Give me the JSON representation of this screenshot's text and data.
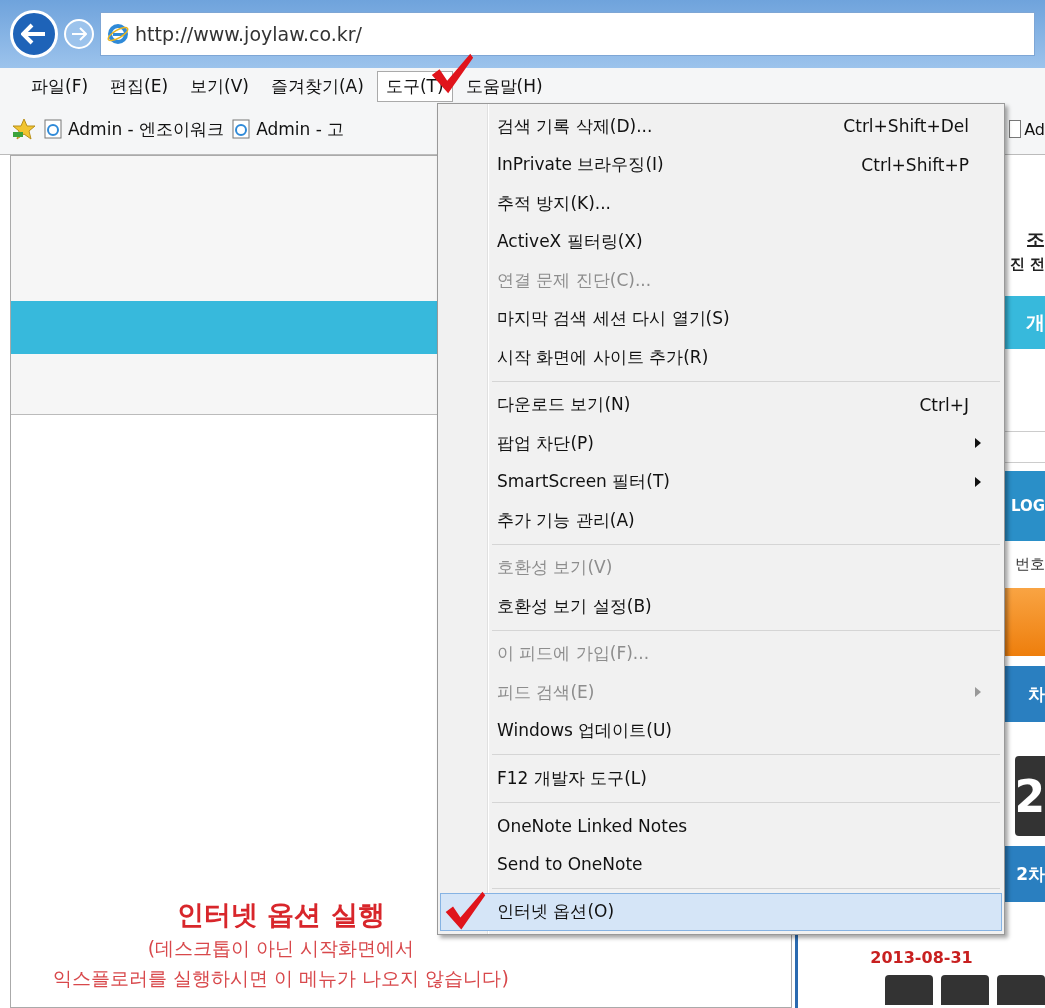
{
  "address_bar": {
    "url": "http://www.joylaw.co.kr/"
  },
  "menu_bar": [
    {
      "label": "파일(F)",
      "selected": false
    },
    {
      "label": "편집(E)",
      "selected": false
    },
    {
      "label": "보기(V)",
      "selected": false
    },
    {
      "label": "즐겨찾기(A)",
      "selected": false
    },
    {
      "label": "도구(T)",
      "selected": true
    },
    {
      "label": "도움말(H)",
      "selected": false
    }
  ],
  "favorites": [
    "Admin - 엔조이워크",
    "Admin - 고",
    "Ad"
  ],
  "right_panel": {
    "title": "조",
    "subtitle": "진 전",
    "tab": "개",
    "login_button": "LOG",
    "label": "번호",
    "button_1": "차",
    "tile": "2",
    "button_2": "2차",
    "date": "2013-08-31"
  },
  "annotation": {
    "title": "인터넷 옵션 실행",
    "lines": [
      "(데스크톱이 아닌 시작화면에서",
      "익스플로러를 실행하시면 이 메뉴가 나오지 않습니다)"
    ]
  },
  "tools_menu": [
    {
      "items": [
        {
          "label": "검색 기록 삭제(D)...",
          "shortcut": "Ctrl+Shift+Del",
          "disabled": false,
          "submenu": false,
          "selected": false
        },
        {
          "label": "InPrivate 브라우징(I)",
          "shortcut": "Ctrl+Shift+P",
          "disabled": false,
          "submenu": false,
          "selected": false
        },
        {
          "label": "추적 방지(K)...",
          "disabled": false,
          "submenu": false,
          "selected": false
        },
        {
          "label": "ActiveX 필터링(X)",
          "disabled": false,
          "submenu": false,
          "selected": false
        },
        {
          "label": "연결 문제 진단(C)...",
          "disabled": true,
          "submenu": false,
          "selected": false
        },
        {
          "label": "마지막 검색 세션 다시 열기(S)",
          "disabled": false,
          "submenu": false,
          "selected": false
        },
        {
          "label": "시작 화면에 사이트 추가(R)",
          "disabled": false,
          "submenu": false,
          "selected": false
        }
      ]
    },
    {
      "items": [
        {
          "label": "다운로드 보기(N)",
          "shortcut": "Ctrl+J",
          "disabled": false,
          "submenu": false,
          "selected": false
        },
        {
          "label": "팝업 차단(P)",
          "disabled": false,
          "submenu": true,
          "selected": false
        },
        {
          "label": "SmartScreen 필터(T)",
          "disabled": false,
          "submenu": true,
          "selected": false
        },
        {
          "label": "추가 기능 관리(A)",
          "disabled": false,
          "submenu": false,
          "selected": false
        }
      ]
    },
    {
      "items": [
        {
          "label": "호환성 보기(V)",
          "disabled": true,
          "submenu": false,
          "selected": false
        },
        {
          "label": "호환성 보기 설정(B)",
          "disabled": false,
          "submenu": false,
          "selected": false
        }
      ]
    },
    {
      "items": [
        {
          "label": "이 피드에 가입(F)...",
          "disabled": true,
          "submenu": false,
          "selected": false
        },
        {
          "label": "피드 검색(E)",
          "disabled": true,
          "submenu": true,
          "selected": false
        },
        {
          "label": "Windows 업데이트(U)",
          "disabled": false,
          "submenu": false,
          "selected": false
        }
      ]
    },
    {
      "items": [
        {
          "label": "F12 개발자 도구(L)",
          "disabled": false,
          "submenu": false,
          "selected": false
        }
      ]
    },
    {
      "items": [
        {
          "label": "OneNote Linked Notes",
          "disabled": false,
          "submenu": false,
          "selected": false
        },
        {
          "label": "Send to OneNote",
          "disabled": false,
          "submenu": false,
          "selected": false
        }
      ]
    },
    {
      "items": [
        {
          "label": "인터넷 옵션(O)",
          "disabled": false,
          "submenu": false,
          "selected": true
        }
      ]
    }
  ]
}
